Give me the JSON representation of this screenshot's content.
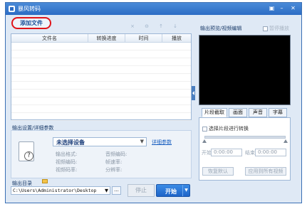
{
  "window": {
    "title": "暴风转码"
  },
  "toolbar": {
    "add_file": "添加文件",
    "icons": [
      "×",
      "⊖",
      "↑",
      "↓"
    ]
  },
  "file_list": {
    "columns": [
      "文件名",
      "转换进度",
      "时间",
      "播放"
    ],
    "rows": []
  },
  "output_settings": {
    "section_label": "输出设置/详细参数",
    "device": "未选择设备",
    "details_link": "详细参数",
    "left_fields": [
      "输出格式:",
      "视频编码:",
      "视频码率:"
    ],
    "right_fields": [
      "音频编码:",
      "帧速率:",
      "分辨率:"
    ]
  },
  "output_dir": {
    "label": "输出目录",
    "path": "C:\\Users\\Administrator\\Desktop",
    "browse": "..."
  },
  "actions": {
    "stop": "停止",
    "start": "开始"
  },
  "preview": {
    "label": "输出预览/视频编辑",
    "mute": "暂停播放"
  },
  "edit_tabs": [
    "片段截取",
    "画面",
    "声音",
    "字幕"
  ],
  "clip": {
    "checkbox": "选择片段进行转换",
    "start_label": "开始",
    "start_time": "0:00:00",
    "end_label": "结束",
    "end_time": "0:00:00",
    "reset": "恢复默认",
    "apply_all": "应用到所有视频"
  }
}
